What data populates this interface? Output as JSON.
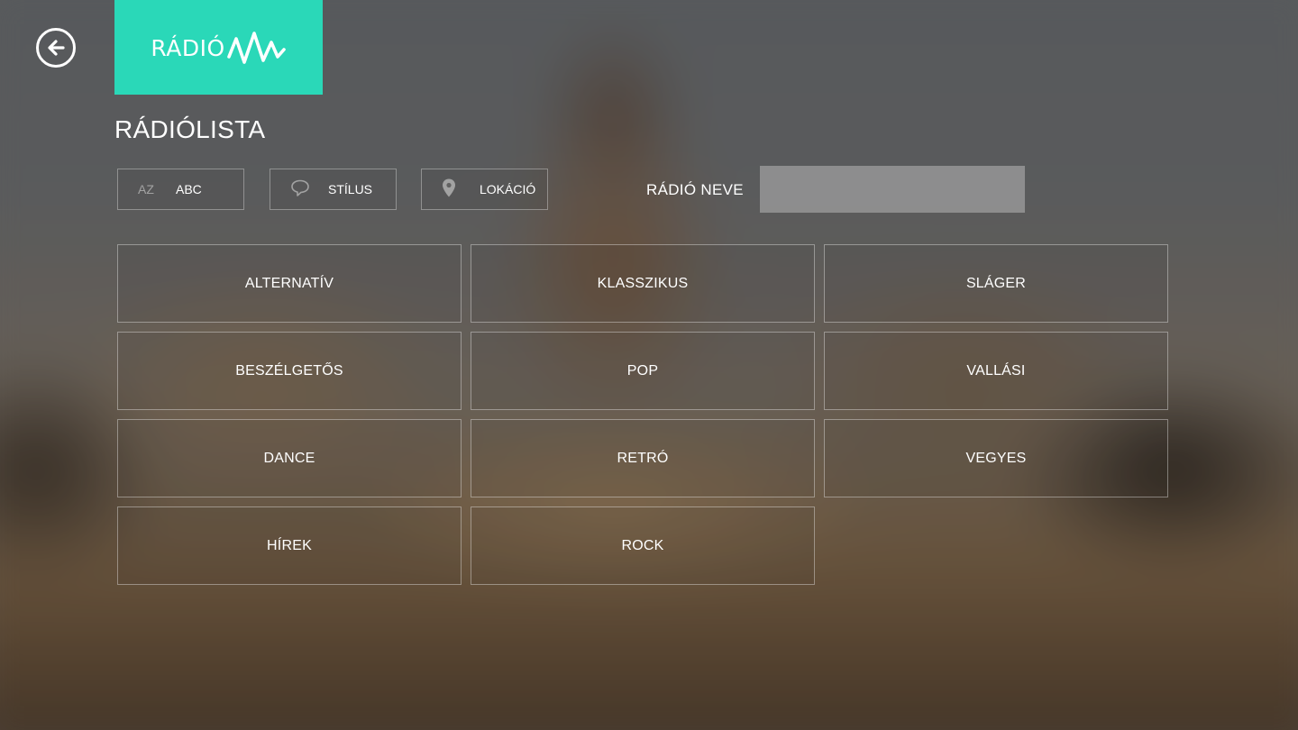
{
  "header": {
    "logo_text": "RÁDIÓ",
    "accent_color": "#2ad8b8"
  },
  "page": {
    "title": "RÁDIÓLISTA"
  },
  "filters": {
    "abc": {
      "icon_text": "AZ",
      "label": "ABC"
    },
    "style": {
      "icon": "speech-bubble-icon",
      "label": "STÍLUS"
    },
    "location": {
      "icon": "location-pin-icon",
      "label": "LOKÁCIÓ"
    }
  },
  "search": {
    "label": "RÁDIÓ NEVE",
    "value": "",
    "placeholder": ""
  },
  "genres": [
    "ALTERNATÍV",
    "KLASSZIKUS",
    "SLÁGER",
    "BESZÉLGETŐS",
    "POP",
    "VALLÁSI",
    "DANCE",
    "RETRÓ",
    "VEGYES",
    "HÍREK",
    "ROCK"
  ]
}
